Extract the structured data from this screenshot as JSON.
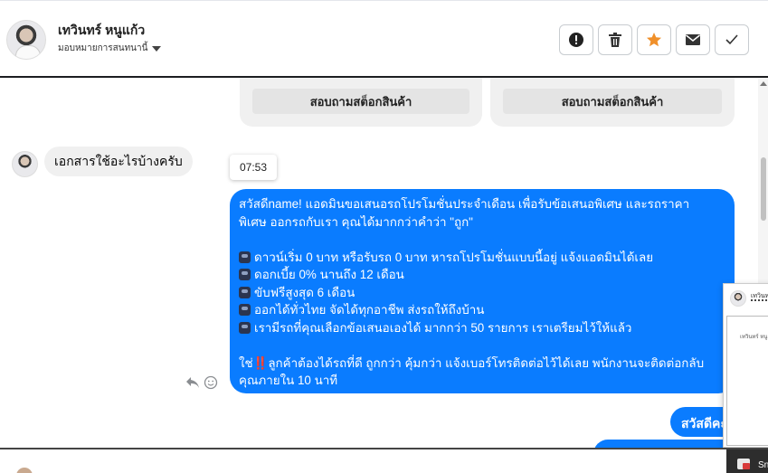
{
  "header": {
    "contact_name": "เทวินทร์ หนูแก้ว",
    "assigned_to": "มอบหมายการสนทนานี้",
    "actions": [
      {
        "name": "report",
        "icon": "exclamation-icon"
      },
      {
        "name": "delete",
        "icon": "trash-icon"
      },
      {
        "name": "star",
        "icon": "star-icon",
        "color": "#f0902a"
      },
      {
        "name": "email",
        "icon": "envelope-icon"
      },
      {
        "name": "done",
        "icon": "check-icon"
      }
    ]
  },
  "cards": [
    {
      "button_label": "สอบถามสต็อกสินค้า"
    },
    {
      "button_label": "สอบถามสต็อกสินค้า"
    }
  ],
  "incoming": {
    "message": "เอกสารใช้อะไรบ้างครับ"
  },
  "timestamp_tooltip": "07:53",
  "outgoing": {
    "line1": "สวัสดีname! แอดมินขอเสนอรถโปรโมชั่นประจำเดือน เพื่อรับข้อเสนอพิเศษ และรถราคา",
    "line2": "พิเศษ ออกรถกับเรา คุณได้มากกว่าคำว่า \"ถูก\"",
    "bullets": [
      "ดาวน์เริ่ม 0 บาท หรือรับรถ 0 บาท หารถโปรโมชั่นแบบนี้อยู่ แจ้งแอดมินได้เลย",
      "ดอกเบี้ย 0% นานถึง 12 เดือน",
      "ขับฟรีสูงสุด 6 เดือน",
      "ออกได้ทั่วไทย จัดได้ทุกอาชีพ ส่งรถให้ถึงบ้าน",
      "เรามีรถที่คุณเลือกข้อเสนอเองได้ มากกว่า 50 รายการ เราเตรียมไว้ให้แล้ว"
    ],
    "closing_prefix": "ใช่",
    "closing_bang": "‼️",
    "closing_line1": "ลูกค้าต้องได้รถที่ดี ถูกกว่า คุ้มกว่า แจ้งเบอร์โทรติดต่อไว้ได้เลย พนักงานจะติดต่อกลับ",
    "closing_line2": "คุณภายใน 10 นาที"
  },
  "outgoing2": {
    "message": "สวัสดีคะ"
  },
  "popup": {
    "name": "เทวินทร",
    "inner_text": "เทวินทร์ หนู"
  },
  "taskbar": {
    "label": "Sn"
  },
  "colors": {
    "outgoing_bubble": "#0a7cff",
    "incoming_bubble": "#f0f0f0",
    "star": "#f0902a"
  }
}
